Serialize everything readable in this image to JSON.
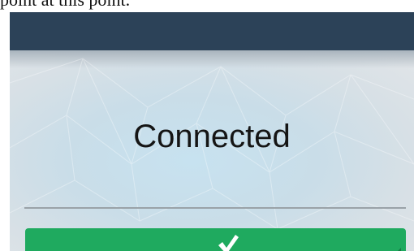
{
  "caption": {
    "text": "point at this point."
  },
  "screen": {
    "status_text": "Connected"
  },
  "confirm_button": {
    "icon": "checkmark-icon",
    "corner_icon": "corner-triangle-icon"
  },
  "colors": {
    "status_bar": "#2c4258",
    "button": "#1faa5f",
    "check": "#ffffff"
  }
}
